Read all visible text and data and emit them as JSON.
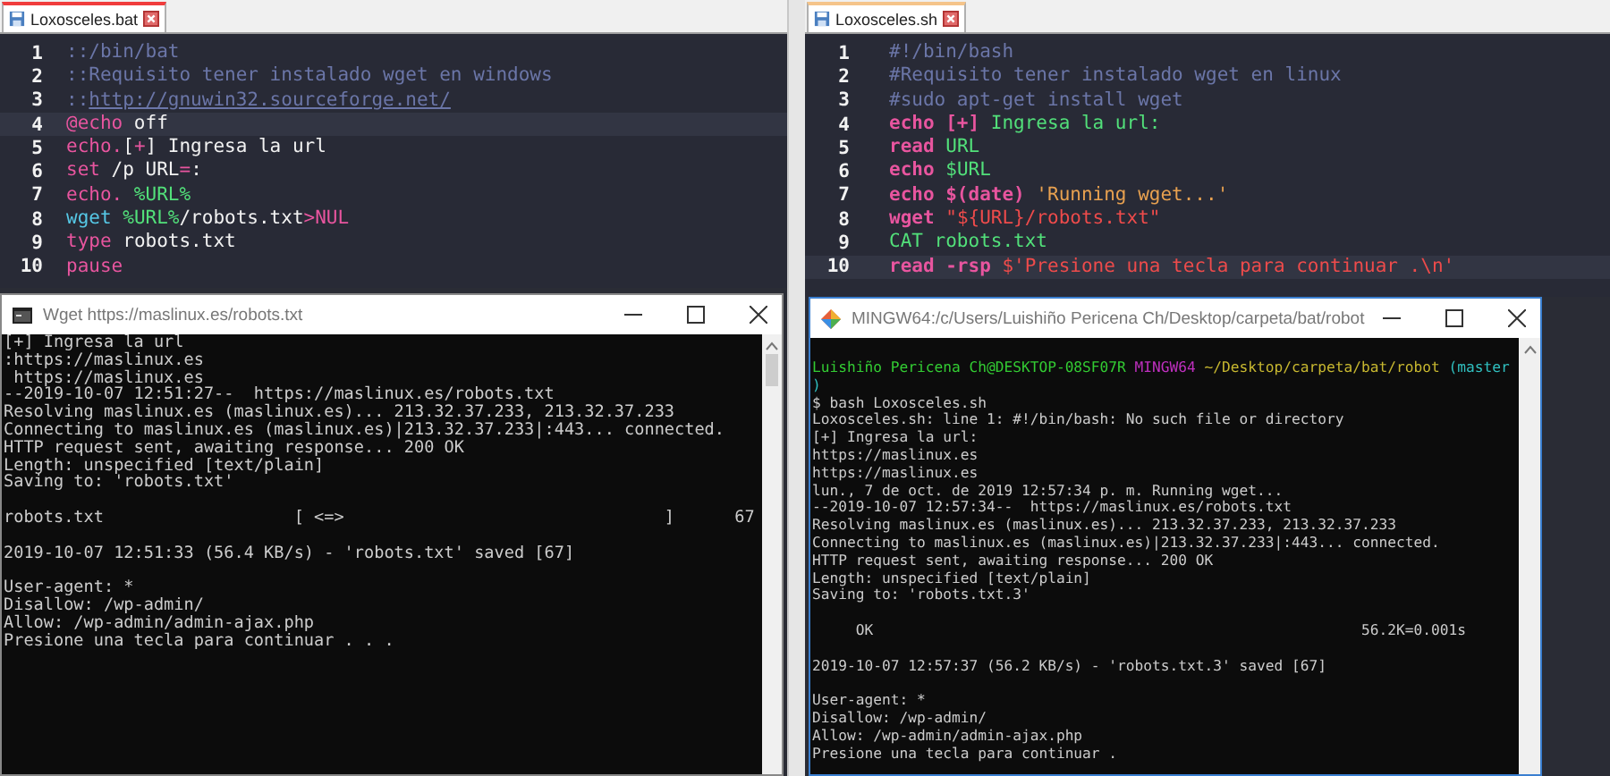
{
  "editors": [
    {
      "tab": {
        "label": "Loxosceles.bat",
        "selected": true
      },
      "lines": [
        {
          "number": "1",
          "highlighted": false,
          "tokens": [
            {
              "kind": "comment",
              "text": "::/bin/bat"
            }
          ]
        },
        {
          "number": "2",
          "highlighted": false,
          "tokens": [
            {
              "kind": "comment",
              "text": "::Requisito tener instalado wget en windows"
            }
          ]
        },
        {
          "number": "3",
          "highlighted": false,
          "tokens": [
            {
              "kind": "comment",
              "text": "::"
            },
            {
              "kind": "link",
              "text": "http://gnuwin32.sourceforge.net/"
            }
          ]
        },
        {
          "number": "4",
          "highlighted": true,
          "tokens": [
            {
              "kind": "keyword",
              "text": "@echo"
            },
            {
              "kind": "plain",
              "text": " off"
            }
          ]
        },
        {
          "number": "5",
          "highlighted": false,
          "tokens": [
            {
              "kind": "keyword",
              "text": "echo."
            },
            {
              "kind": "plain",
              "text": "["
            },
            {
              "kind": "keyword",
              "text": "+"
            },
            {
              "kind": "plain",
              "text": "] Ingresa la url"
            }
          ]
        },
        {
          "number": "6",
          "highlighted": false,
          "tokens": [
            {
              "kind": "keyword",
              "text": "set"
            },
            {
              "kind": "plain",
              "text": " /p URL"
            },
            {
              "kind": "keyword",
              "text": "="
            },
            {
              "kind": "plain",
              "text": ":"
            }
          ]
        },
        {
          "number": "7",
          "highlighted": false,
          "tokens": [
            {
              "kind": "keyword",
              "text": "echo."
            },
            {
              "kind": "variable",
              "text": " %URL%"
            }
          ]
        },
        {
          "number": "8",
          "highlighted": false,
          "tokens": [
            {
              "kind": "builtin",
              "text": "wget"
            },
            {
              "kind": "variable",
              "text": " %URL%"
            },
            {
              "kind": "plain",
              "text": "/robots.txt"
            },
            {
              "kind": "keyword",
              "text": ">NUL"
            }
          ]
        },
        {
          "number": "9",
          "highlighted": false,
          "tokens": [
            {
              "kind": "keyword",
              "text": "type"
            },
            {
              "kind": "plain",
              "text": " robots.txt"
            }
          ]
        },
        {
          "number": "10",
          "highlighted": false,
          "tokens": [
            {
              "kind": "keyword",
              "text": "pause"
            }
          ]
        }
      ]
    },
    {
      "tab": {
        "label": "Loxosceles.sh",
        "selected": false
      },
      "lines": [
        {
          "number": "1",
          "highlighted": false,
          "tokens": [
            {
              "kind": "comment",
              "text": "#!/bin/bash"
            }
          ]
        },
        {
          "number": "2",
          "highlighted": false,
          "tokens": [
            {
              "kind": "comment",
              "text": "#Requisito tener instalado wget en linux"
            }
          ]
        },
        {
          "number": "3",
          "highlighted": false,
          "tokens": [
            {
              "kind": "comment",
              "text": "#sudo apt-get install wget"
            }
          ]
        },
        {
          "number": "4",
          "highlighted": false,
          "tokens": [
            {
              "kind": "keyword",
              "text": "echo [+]"
            },
            {
              "kind": "variable",
              "text": " Ingresa la url:"
            }
          ]
        },
        {
          "number": "5",
          "highlighted": false,
          "tokens": [
            {
              "kind": "keyword",
              "text": "read"
            },
            {
              "kind": "variable",
              "text": " URL"
            }
          ]
        },
        {
          "number": "6",
          "highlighted": false,
          "tokens": [
            {
              "kind": "keyword",
              "text": "echo"
            },
            {
              "kind": "variable",
              "text": " $URL"
            }
          ]
        },
        {
          "number": "7",
          "highlighted": false,
          "tokens": [
            {
              "kind": "keyword",
              "text": "echo $(date)"
            },
            {
              "kind": "string",
              "text": " 'Running wget...'"
            }
          ]
        },
        {
          "number": "8",
          "highlighted": false,
          "tokens": [
            {
              "kind": "keyword",
              "text": "wget"
            },
            {
              "kind": "literal",
              "text": " \"${URL}/robots.txt\""
            }
          ]
        },
        {
          "number": "9",
          "highlighted": false,
          "tokens": [
            {
              "kind": "variable",
              "text": "CAT robots.txt"
            }
          ]
        },
        {
          "number": "10",
          "highlighted": true,
          "tokens": [
            {
              "kind": "keyword",
              "text": "read -rsp"
            },
            {
              "kind": "literal",
              "text": " $'Presione una tecla para continuar .\\n'"
            }
          ]
        }
      ]
    }
  ],
  "terminals": [
    {
      "kind": "cmd",
      "title": "Wget https://maslinux.es/robots.txt",
      "lines": [
        {
          "kind": "text",
          "text": "[+] Ingresa la url"
        },
        {
          "kind": "text",
          "text": ":https://maslinux.es"
        },
        {
          "kind": "text",
          "text": " https://maslinux.es"
        },
        {
          "kind": "text",
          "text": "--2019-10-07 12:51:27--  https://maslinux.es/robots.txt"
        },
        {
          "kind": "text",
          "text": "Resolving maslinux.es (maslinux.es)... 213.32.37.233, 213.32.37.233"
        },
        {
          "kind": "text",
          "text": "Connecting to maslinux.es (maslinux.es)|213.32.37.233|:443... connected."
        },
        {
          "kind": "text",
          "text": "HTTP request sent, awaiting response... 200 OK"
        },
        {
          "kind": "text",
          "text": "Length: unspecified [text/plain]"
        },
        {
          "kind": "text",
          "text": "Saving to: 'robots.txt'"
        },
        {
          "kind": "blank"
        },
        {
          "kind": "text",
          "text": "robots.txt                   [ <=>                                ]      67"
        },
        {
          "kind": "blank"
        },
        {
          "kind": "text",
          "text": "2019-10-07 12:51:33 (56.4 KB/s) - 'robots.txt' saved [67]"
        },
        {
          "kind": "blank"
        },
        {
          "kind": "text",
          "text": "User-agent: *"
        },
        {
          "kind": "text",
          "text": "Disallow: /wp-admin/"
        },
        {
          "kind": "text",
          "text": "Allow: /wp-admin/admin-ajax.php"
        },
        {
          "kind": "text",
          "text": "Presione una tecla para continuar . . ."
        }
      ]
    },
    {
      "kind": "mingw",
      "title": "MINGW64:/c/Users/Luishiño Pericena Ch/Desktop/carpeta/bat/robot",
      "lines": [
        {
          "kind": "prompt",
          "segments": [
            {
              "kind": "user",
              "text": "Luishiño Pericena Ch@DESKTOP-08SF07R"
            },
            {
              "kind": "env",
              "text": " MINGW64"
            },
            {
              "kind": "path",
              "text": " ~/Desktop/carpeta/bat/robot"
            },
            {
              "kind": "branch",
              "text": " (master"
            }
          ]
        },
        {
          "kind": "prompt",
          "segments": [
            {
              "kind": "branch",
              "text": ")"
            }
          ]
        },
        {
          "kind": "text",
          "text": "$ bash Loxosceles.sh"
        },
        {
          "kind": "text",
          "text": "Loxosceles.sh: line 1: #!/bin/bash: No such file or directory"
        },
        {
          "kind": "text",
          "text": "[+] Ingresa la url:"
        },
        {
          "kind": "text",
          "text": "https://maslinux.es"
        },
        {
          "kind": "text",
          "text": "https://maslinux.es"
        },
        {
          "kind": "text",
          "text": "lun., 7 de oct. de 2019 12:57:34 p. m. Running wget..."
        },
        {
          "kind": "text",
          "text": "--2019-10-07 12:57:34--  https://maslinux.es/robots.txt"
        },
        {
          "kind": "text",
          "text": "Resolving maslinux.es (maslinux.es)... 213.32.37.233, 213.32.37.233"
        },
        {
          "kind": "text",
          "text": "Connecting to maslinux.es (maslinux.es)|213.32.37.233|:443... connected."
        },
        {
          "kind": "text",
          "text": "HTTP request sent, awaiting response... 200 OK"
        },
        {
          "kind": "text",
          "text": "Length: unspecified [text/plain]"
        },
        {
          "kind": "text",
          "text": "Saving to: 'robots.txt.3'"
        },
        {
          "kind": "blank"
        },
        {
          "kind": "text",
          "text": "     OK                                                        56.2K=0.001s"
        },
        {
          "kind": "blank"
        },
        {
          "kind": "text",
          "text": "2019-10-07 12:57:37 (56.2 KB/s) - 'robots.txt.3' saved [67]"
        },
        {
          "kind": "blank"
        },
        {
          "kind": "text",
          "text": "User-agent: *"
        },
        {
          "kind": "text",
          "text": "Disallow: /wp-admin/"
        },
        {
          "kind": "text",
          "text": "Allow: /wp-admin/admin-ajax.php"
        },
        {
          "kind": "text",
          "text": "Presione una tecla para continuar ."
        }
      ]
    }
  ]
}
